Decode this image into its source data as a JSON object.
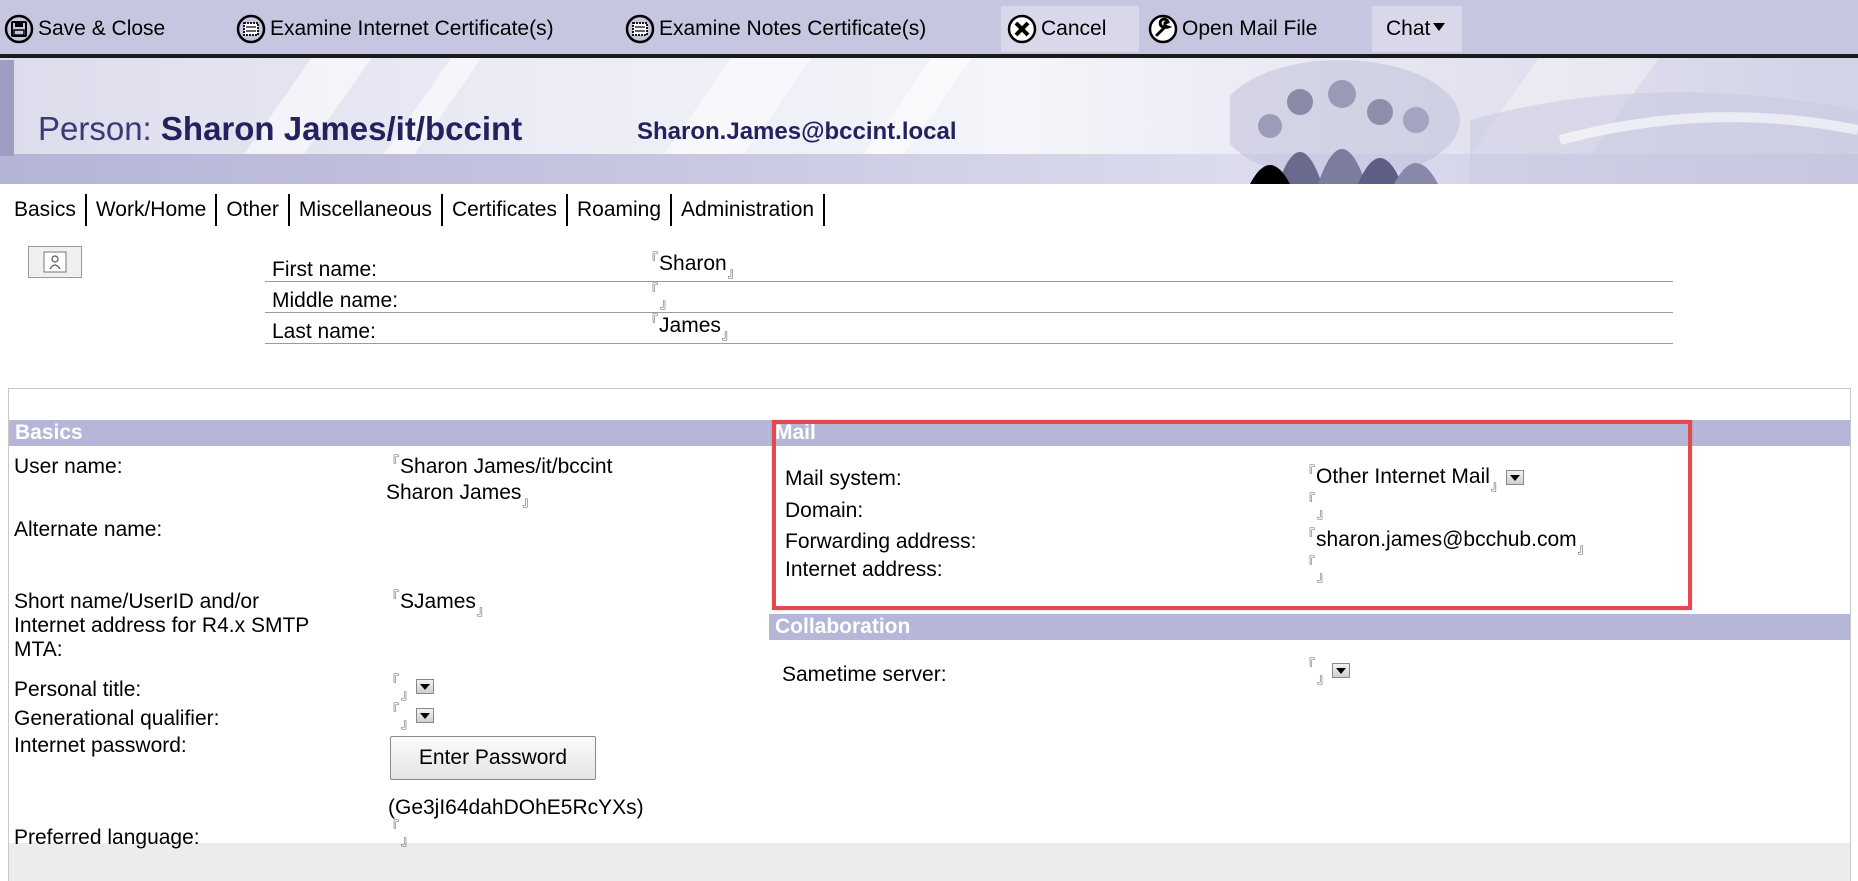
{
  "toolbar": {
    "save_close": "Save & Close",
    "examine_internet": "Examine Internet Certificate(s)",
    "examine_notes": "Examine Notes Certificate(s)",
    "cancel": "Cancel",
    "open_mail": "Open Mail File",
    "chat": "Chat"
  },
  "header": {
    "label": "Person:",
    "name": "Sharon James/it/bccint",
    "email": "Sharon.James@bccint.local"
  },
  "tabs": [
    "Basics",
    "Work/Home",
    "Other",
    "Miscellaneous",
    "Certificates",
    "Roaming",
    "Administration"
  ],
  "names": {
    "first_label": "First name:",
    "first_value": "Sharon",
    "middle_label": "Middle name:",
    "middle_value": "",
    "last_label": "Last name:",
    "last_value": "James"
  },
  "basics": {
    "header": "Basics",
    "user_name_label": "User name:",
    "user_name_line1": "Sharon James/it/bccint",
    "user_name_line2": "Sharon James",
    "alternate_name_label": "Alternate name:",
    "short_name_label_1": "Short name/UserID and/or",
    "short_name_label_2": "Internet address for R4.x SMTP",
    "short_name_label_3": "MTA:",
    "short_name_value": "SJames",
    "personal_title_label": "Personal title:",
    "generational_label": "Generational qualifier:",
    "internet_password_label": "Internet password:",
    "enter_password_button": "Enter Password",
    "password_hash": "(Ge3jI64dahDOhE5RcYXs)",
    "preferred_language_label": "Preferred language:"
  },
  "mail": {
    "header": "Mail",
    "mail_system_label": "Mail system:",
    "mail_system_value": "Other Internet Mail",
    "domain_label": "Domain:",
    "domain_value": "",
    "forwarding_label": "Forwarding address:",
    "forwarding_value": "sharon.james@bcchub.com",
    "internet_address_label": "Internet address:",
    "internet_address_value": ""
  },
  "collaboration": {
    "header": "Collaboration",
    "sametime_label": "Sametime server:",
    "sametime_value": ""
  },
  "colors": {
    "toolbar_bg": "#c6c6e0",
    "section_band": "#b6b6d8",
    "highlight": "#e24a4f",
    "title_text": "#22225e"
  },
  "icons": [
    "save-icon",
    "certificate-icon",
    "cancel-icon",
    "wrench-icon",
    "picture-icon"
  ]
}
